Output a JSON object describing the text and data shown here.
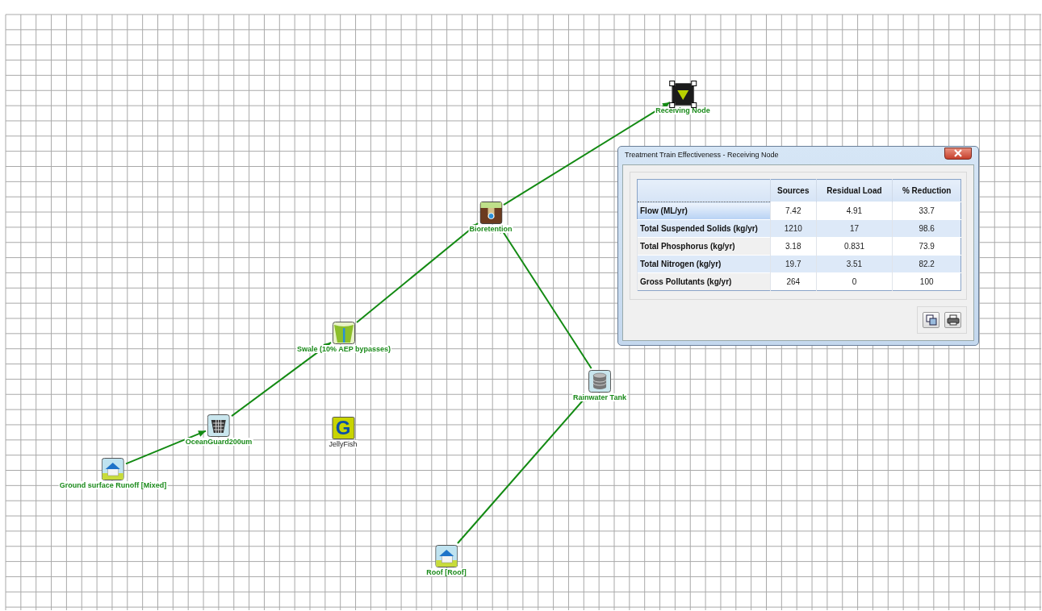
{
  "canvas": {
    "nodes": [
      {
        "kind": "receiving",
        "label": "Receiving Node",
        "selected": true,
        "linked": true
      },
      {
        "kind": "bioretention",
        "label": "Bioretention",
        "selected": false,
        "linked": true
      },
      {
        "kind": "swale",
        "label": "Swale (10% AEP bypasses)",
        "selected": false,
        "linked": true
      },
      {
        "kind": "gpt",
        "label": "OceanGuard200um",
        "selected": false,
        "linked": true
      },
      {
        "kind": "letter",
        "icon_letter": "G",
        "label": "JellyFish",
        "selected": false,
        "linked": false
      },
      {
        "kind": "source",
        "label": "Ground surface Runoff [Mixed]",
        "selected": false,
        "linked": true
      },
      {
        "kind": "tank",
        "label": "Rainwater Tank",
        "selected": false,
        "linked": true
      },
      {
        "kind": "source",
        "label": "Roof [Roof]",
        "selected": false,
        "linked": true
      }
    ]
  },
  "dialog": {
    "title": "Treatment Train Effectiveness - Receiving Node",
    "table": {
      "columns": [
        "Sources",
        "Residual Load",
        "% Reduction"
      ],
      "rows": [
        {
          "label": "Flow (ML/yr)",
          "values": [
            "7.42",
            "4.91",
            "33.7"
          ],
          "selected": true
        },
        {
          "label": "Total Suspended Solids (kg/yr)",
          "values": [
            "1210",
            "17",
            "98.6"
          ],
          "selected": false
        },
        {
          "label": "Total Phosphorus (kg/yr)",
          "values": [
            "3.18",
            "0.831",
            "73.9"
          ],
          "selected": false
        },
        {
          "label": "Total Nitrogen (kg/yr)",
          "values": [
            "19.7",
            "3.51",
            "82.2"
          ],
          "selected": false
        },
        {
          "label": "Gross Pollutants (kg/yr)",
          "values": [
            "264",
            "0",
            "100"
          ],
          "selected": false
        }
      ]
    }
  }
}
